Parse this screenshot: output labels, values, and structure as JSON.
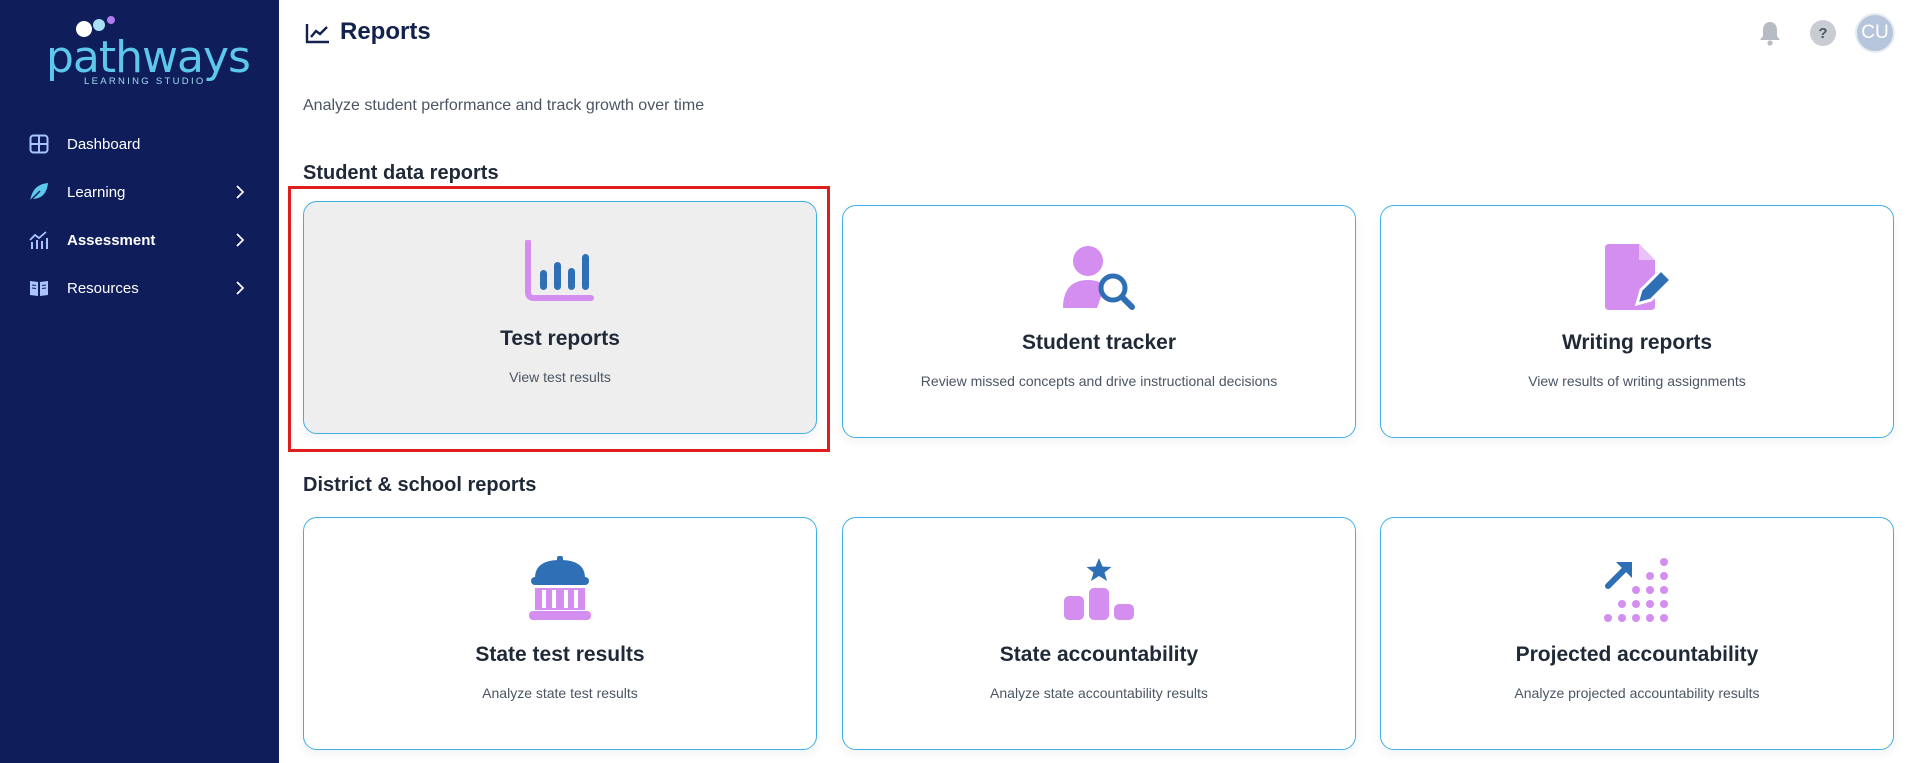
{
  "sidebar": {
    "logo": {
      "word": "pathways",
      "tagline": "LEARNING STUDIO"
    },
    "items": [
      {
        "label": "Dashboard",
        "icon": "grid-icon",
        "expandable": false
      },
      {
        "label": "Learning",
        "icon": "leaf-icon",
        "expandable": true
      },
      {
        "label": "Assessment",
        "icon": "chart-icon",
        "expandable": true,
        "active": true
      },
      {
        "label": "Resources",
        "icon": "book-icon",
        "expandable": true
      }
    ]
  },
  "header": {
    "title": "Reports",
    "title_icon": "line-chart-icon",
    "help_label": "?",
    "avatar_initials": "CU"
  },
  "page": {
    "subtitle": "Analyze student performance and track growth over time"
  },
  "sections": [
    {
      "title": "Student data reports",
      "cards": [
        {
          "title": "Test reports",
          "description": "View test results",
          "icon": "bar-chart-icon",
          "selected": true
        },
        {
          "title": "Student tracker",
          "description": "Review missed concepts and drive instructional decisions",
          "icon": "student-search-icon"
        },
        {
          "title": "Writing reports",
          "description": "View results of writing assignments",
          "icon": "document-pencil-icon"
        }
      ]
    },
    {
      "title": "District & school reports",
      "cards": [
        {
          "title": "State test results",
          "description": "Analyze state test results",
          "icon": "capitol-building-icon"
        },
        {
          "title": "State accountability",
          "description": "Analyze state accountability results",
          "icon": "podium-star-icon"
        },
        {
          "title": "Projected accountability",
          "description": "Analyze projected accountability results",
          "icon": "trend-arrow-dots-icon"
        }
      ]
    }
  ],
  "colors": {
    "sidebar": "#0f1d5a",
    "accent_blue": "#2f6fb5",
    "accent_purple": "#d38ef0",
    "card_border": "#3fb0e4",
    "highlight": "#e01d1d"
  }
}
